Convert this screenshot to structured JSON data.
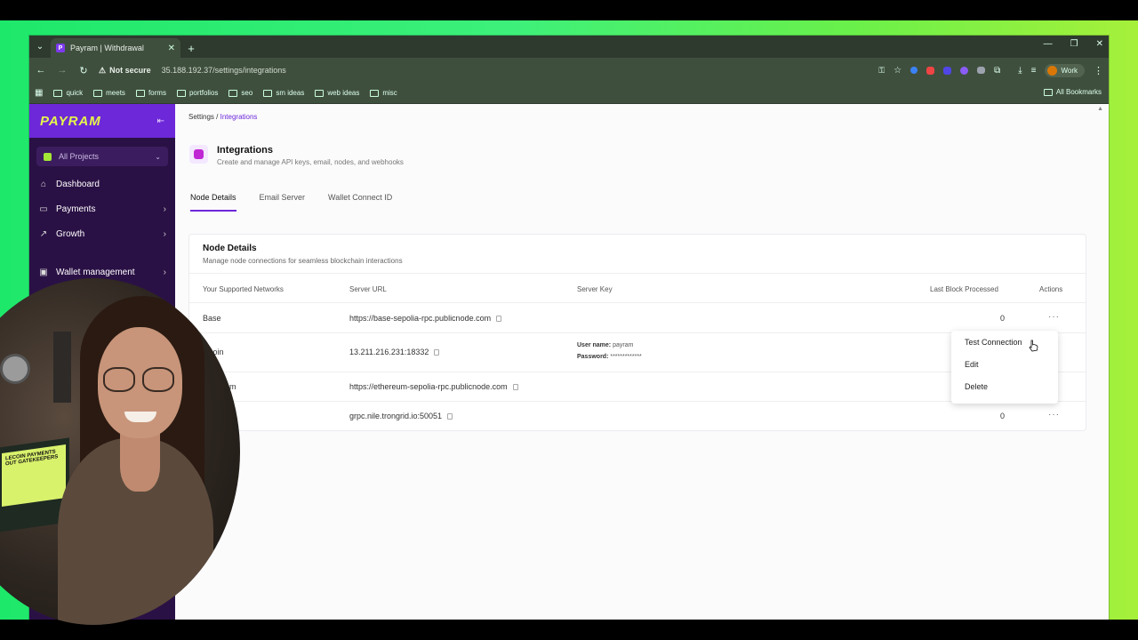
{
  "browser": {
    "tab_title": "Payram | Withdrawal",
    "tab_favicon": "P",
    "not_secure": "Not secure",
    "url": "35.188.192.37/settings/integrations",
    "profile": "Work",
    "bookmarks": [
      "quick",
      "meets",
      "forms",
      "portfolios",
      "seo",
      "sm ideas",
      "web ideas",
      "misc"
    ],
    "all_bookmarks": "All Bookmarks"
  },
  "sidebar": {
    "logo": "PAYRAM",
    "project": "All Projects",
    "items": [
      {
        "label": "Dashboard",
        "icon": "home-icon"
      },
      {
        "label": "Payments",
        "icon": "card-icon"
      },
      {
        "label": "Growth",
        "icon": "trend-icon"
      },
      {
        "label": "Wallet management",
        "icon": "wallet-icon"
      }
    ]
  },
  "breadcrumb": {
    "parent": "Settings",
    "sep": "/",
    "current": "Integrations"
  },
  "page": {
    "title": "Integrations",
    "subtitle": "Create and manage API keys, email, nodes, and webhooks"
  },
  "tabs": [
    "Node Details",
    "Email Server",
    "Wallet Connect ID"
  ],
  "card": {
    "title": "Node Details",
    "subtitle": "Manage node connections for seamless blockchain interactions",
    "columns": [
      "Your Supported Networks",
      "Server URL",
      "Server Key",
      "Last Block Processed",
      "Actions"
    ],
    "rows": [
      {
        "network": "Base",
        "url": "https://base-sepolia-rpc.publicnode.com",
        "key_user_label": "",
        "key_user": "",
        "key_pass_label": "",
        "key_pass": "",
        "last_block": "0",
        "actions": "···"
      },
      {
        "network": "coin",
        "url": "13.211.216.231:18332",
        "key_user_label": "User name:",
        "key_user": "payram",
        "key_pass_label": "Password:",
        "key_pass": "*************",
        "last_block": "",
        "actions": ""
      },
      {
        "network": "m",
        "url": "https://ethereum-sepolia-rpc.publicnode.com",
        "key_user_label": "",
        "key_user": "",
        "key_pass_label": "",
        "key_pass": "",
        "last_block": "",
        "actions": ""
      },
      {
        "network": "",
        "url": "grpc.nile.trongrid.io:50051",
        "key_user_label": "",
        "key_user": "",
        "key_pass_label": "",
        "key_pass": "",
        "last_block": "0",
        "actions": "···"
      }
    ]
  },
  "context_menu": [
    "Test Connection",
    "Edit",
    "Delete"
  ],
  "webcam": {
    "laptop_text": "LECOIN PAYMENTS OUT GATEKEEPERS"
  },
  "colors": {
    "accent": "#6d28d9",
    "sidebar_bg": "#2a1145",
    "logo": "#e6f74b",
    "backdrop": "#3df07a"
  }
}
